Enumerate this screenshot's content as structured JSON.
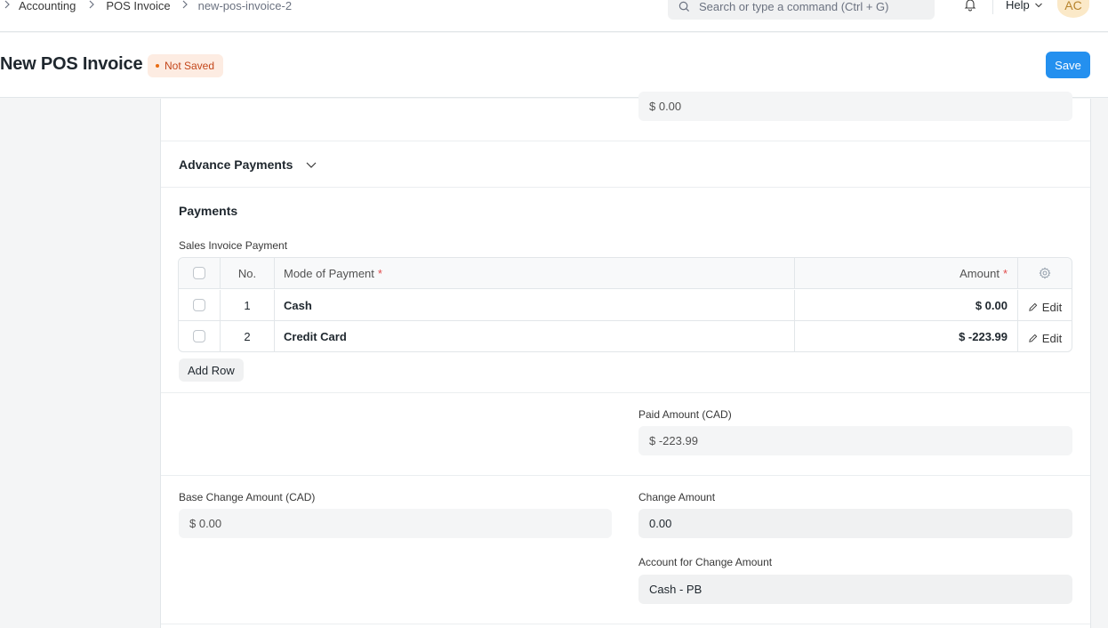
{
  "breadcrumbs": [
    "Accounting",
    "POS Invoice",
    "new-pos-invoice-2"
  ],
  "search": {
    "placeholder": "Search or type a command (Ctrl + G)"
  },
  "nav": {
    "help_label": "Help",
    "avatar_initials": "AC"
  },
  "page": {
    "title": "New POS Invoice",
    "status": "Not Saved",
    "save_label": "Save"
  },
  "top_field": {
    "value": "$ 0.00"
  },
  "advance_payments": {
    "title": "Advance Payments"
  },
  "payments": {
    "title": "Payments",
    "table_label": "Sales Invoice Payment",
    "columns": {
      "no": "No.",
      "mode": "Mode of Payment",
      "amount": "Amount",
      "required_mark": "*"
    },
    "rows": [
      {
        "no": "1",
        "mode": "Cash",
        "amount": "$ 0.00",
        "action": "Edit"
      },
      {
        "no": "2",
        "mode": "Credit Card",
        "amount": "$ -223.99",
        "action": "Edit"
      }
    ],
    "add_row_label": "Add Row"
  },
  "paid_amount": {
    "label": "Paid Amount (CAD)",
    "value": "$ -223.99"
  },
  "base_change_amount": {
    "label": "Base Change Amount (CAD)",
    "value": "$ 0.00"
  },
  "change_amount": {
    "label": "Change Amount",
    "value": "0.00"
  },
  "account_for_change": {
    "label": "Account for Change Amount",
    "value": "Cash - PB"
  },
  "colors": {
    "primary": "#2490ef",
    "status": "#c4471b",
    "required": "#e24c4c",
    "avatar_bg": "#fbe9c8"
  },
  "icons": [
    "chevron-right-icon",
    "search-icon",
    "bell-icon",
    "chevron-down-icon",
    "gear-icon",
    "pencil-icon"
  ]
}
